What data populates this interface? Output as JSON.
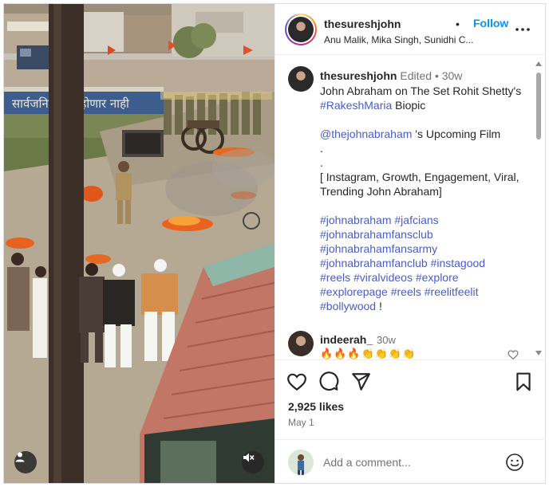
{
  "post": {
    "username": "thesureshjohn",
    "follow_label": "Follow",
    "audio": "Anu Malik, Mika Singh, Sunidhi C...",
    "separator": "•"
  },
  "caption": {
    "username": "thesureshjohn",
    "meta": "Edited • 30w",
    "title_text": "John Abraham on The Set Rohit Shetty's",
    "title_tag": "#RakeshMaria",
    "title_rest": " Biopic",
    "mention": "@thejohnabraham",
    "mention_rest": " 's Upcoming Film",
    "dot1": ".",
    "dot2": ".",
    "keywords": "[ Instagram, Growth, Engagement, Viral, Trending John Abraham]",
    "hashtags_line1": "#johnabraham #jafcians",
    "hashtags_line2": "#johnabrahamfansclub",
    "hashtags_line3": "#johnabrahamfansarmy",
    "hashtags_line4": "#johnabrahamfanclub #instagood",
    "hashtags_line5": "#reels #viralvideos #explore",
    "hashtags_line6": "#explorepage #reels #reelitfeelit",
    "hashtags_line7": "#bollywood",
    "end_mark": " !"
  },
  "comment": {
    "username": "indeerah_",
    "time": "30w",
    "text": "🔥🔥🔥👏👏👏👏"
  },
  "stats": {
    "likes": "2,925 likes",
    "date": "May 1"
  },
  "composer": {
    "placeholder": "Add a comment..."
  },
  "icons": {
    "header_more": "more-horizontal-icon",
    "like": "heart-icon",
    "comment": "comment-bubble-icon",
    "share": "paper-plane-icon",
    "save": "bookmark-icon",
    "emoji": "smiley-icon",
    "tag": "person-tag-icon",
    "mute": "speaker-muted-icon",
    "comment_like": "heart-outline-icon"
  },
  "colors": {
    "follow_blue": "#0095f6",
    "hashtag_blue": "#4a5cc4",
    "text": "#262626",
    "muted": "#737373"
  }
}
